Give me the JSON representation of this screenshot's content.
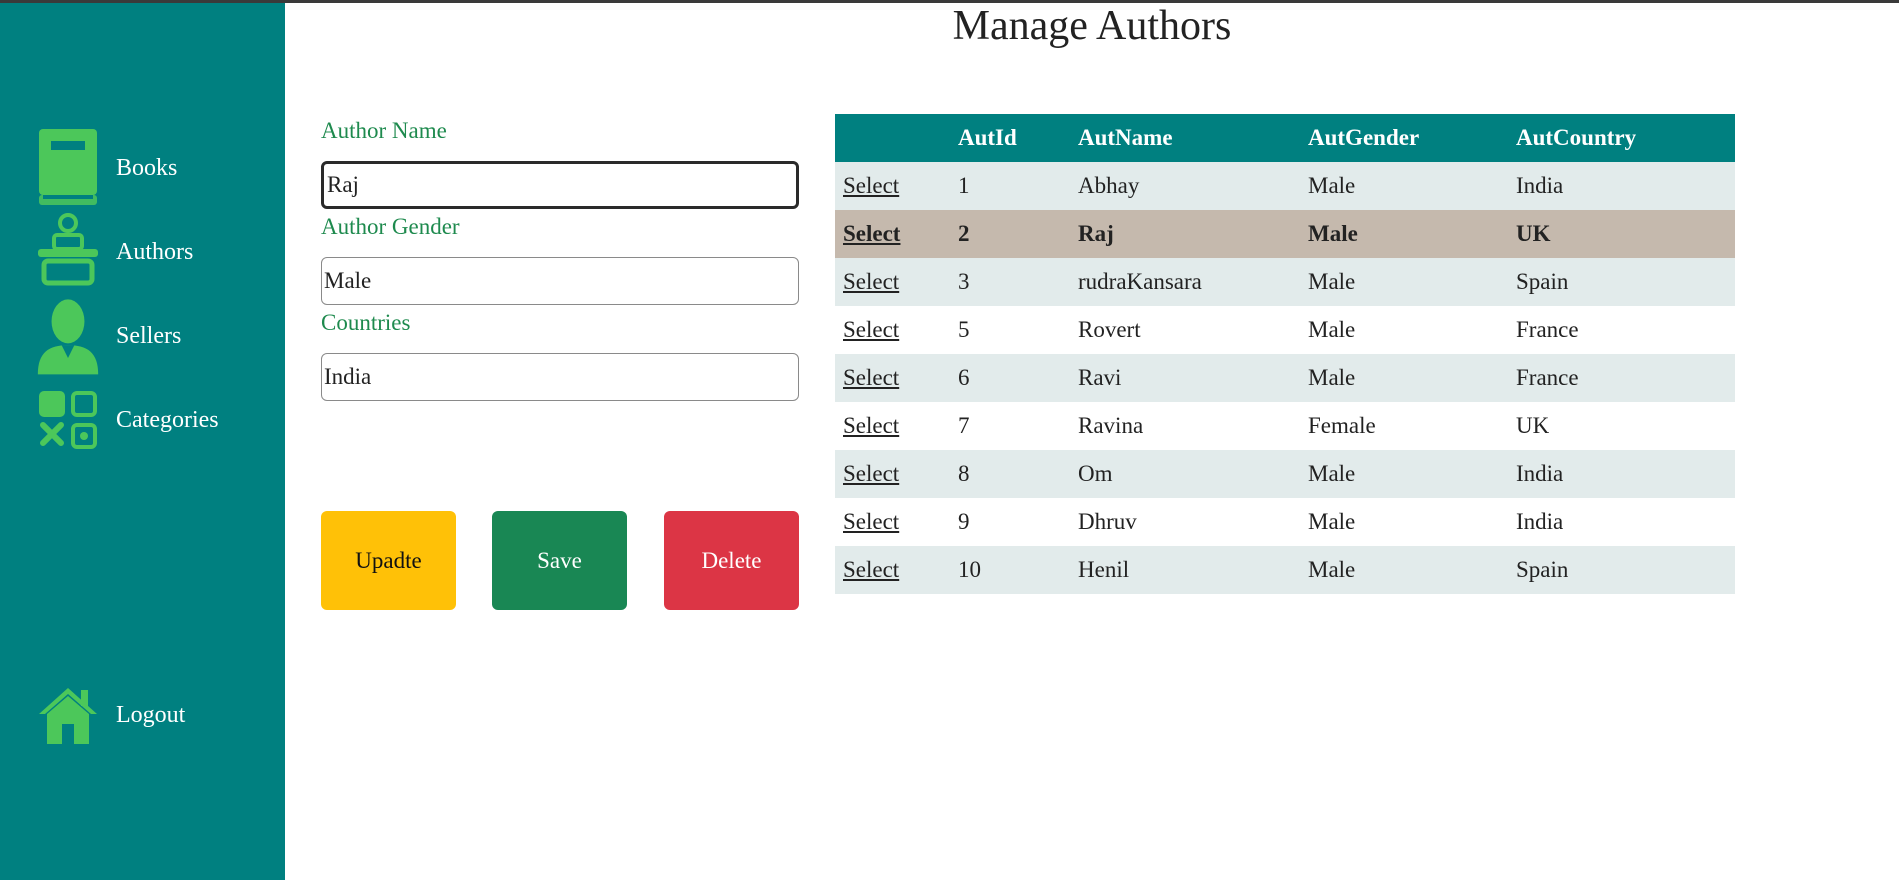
{
  "page": {
    "title": "Manage Authors"
  },
  "colors": {
    "sidebar": "#008080",
    "icon": "#4cc75a",
    "label": "#1e8a4e",
    "selected_row": "#c5b9ad",
    "alt_row": "#e2ebeb",
    "update": "#ffc107",
    "save": "#198754",
    "delete": "#dc3545"
  },
  "sidebar": {
    "items": [
      {
        "label": "Books",
        "icon": "book-icon"
      },
      {
        "label": "Authors",
        "icon": "author-icon"
      },
      {
        "label": "Sellers",
        "icon": "person-icon"
      },
      {
        "label": "Categories",
        "icon": "categories-icon"
      }
    ],
    "logout": {
      "label": "Logout",
      "icon": "home-icon"
    }
  },
  "form": {
    "name_label": "Author Name",
    "name_value": "Raj",
    "gender_label": "Author Gender",
    "gender_value": "Male",
    "country_label": "Countries",
    "country_value": "India"
  },
  "buttons": {
    "update": "Upadte",
    "save": "Save",
    "delete": "Delete"
  },
  "table": {
    "headers": [
      "",
      "AutId",
      "AutName",
      "AutGender",
      "AutCountry"
    ],
    "select_label": "Select",
    "selected_index": 1,
    "rows": [
      {
        "id": "1",
        "name": "Abhay",
        "gender": "Male",
        "country": "India"
      },
      {
        "id": "2",
        "name": "Raj",
        "gender": "Male",
        "country": "UK"
      },
      {
        "id": "3",
        "name": "rudraKansara",
        "gender": "Male",
        "country": "Spain"
      },
      {
        "id": "5",
        "name": "Rovert",
        "gender": "Male",
        "country": "France"
      },
      {
        "id": "6",
        "name": "Ravi",
        "gender": "Male",
        "country": "France"
      },
      {
        "id": "7",
        "name": "Ravina",
        "gender": "Female",
        "country": "UK"
      },
      {
        "id": "8",
        "name": "Om",
        "gender": "Male",
        "country": "India"
      },
      {
        "id": "9",
        "name": "Dhruv",
        "gender": "Male",
        "country": "India"
      },
      {
        "id": "10",
        "name": "Henil",
        "gender": "Male",
        "country": "Spain"
      }
    ]
  }
}
